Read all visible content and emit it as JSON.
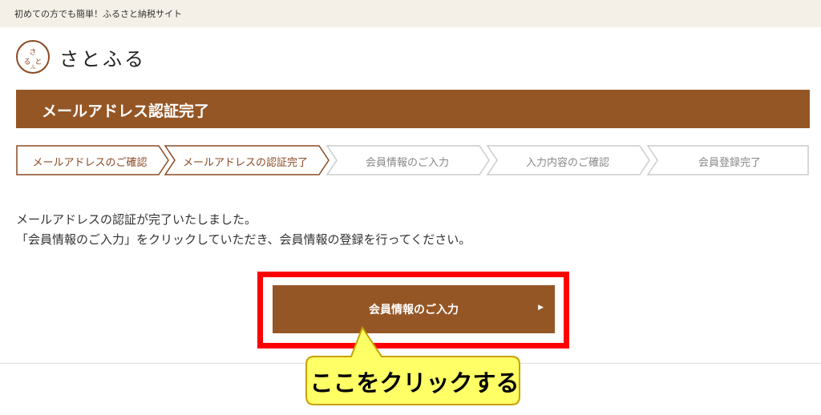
{
  "topbar": {
    "tagline": "初めての方でも簡単！ふるさと納税サイト"
  },
  "logo": {
    "mark_text": "さとふる",
    "name": "さとふる"
  },
  "page": {
    "title": "メールアドレス認証完了"
  },
  "steps": [
    {
      "label": "メールアドレスのご確認",
      "status": "done"
    },
    {
      "label": "メールアドレスの認証完了",
      "status": "current"
    },
    {
      "label": "会員情報のご入力",
      "status": "todo"
    },
    {
      "label": "入力内容のご確認",
      "status": "todo"
    },
    {
      "label": "会員登録完了",
      "status": "todo"
    }
  ],
  "message": {
    "line1": "メールアドレスの認証が完了いたしました。",
    "line2": "「会員情報のご入力」をクリックしていただき、会員情報の登録を行ってください。"
  },
  "cta": {
    "label": "会員情報のご入力",
    "arrow_icon": "triangle-right-icon"
  },
  "callout": {
    "text": "ここをクリックする"
  },
  "colors": {
    "brand": "#955626",
    "topbar_bg": "#f4f0e8",
    "highlight": "#ff0000",
    "callout_bg": "#ffff66",
    "callout_border": "#c8a000"
  }
}
